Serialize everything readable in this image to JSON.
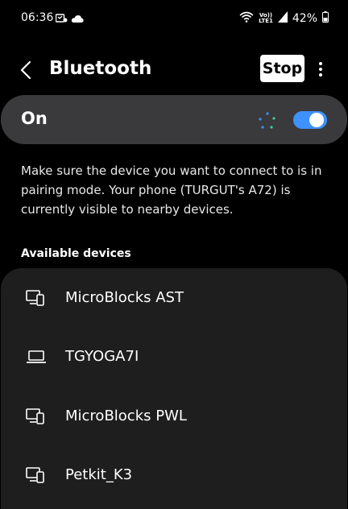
{
  "status_bar": {
    "time": "06:36",
    "left_icons": [
      "vpn-icon",
      "cloud-icon"
    ],
    "right_icons": [
      "wifi-icon",
      "volte-icon",
      "signal-icon",
      "battery-icon"
    ],
    "volte_line1": "Vo))",
    "volte_line2": "LTE1",
    "battery": "42%"
  },
  "header": {
    "title": "Bluetooth",
    "stop_label": "Stop"
  },
  "toggle": {
    "label": "On",
    "enabled": true,
    "accent": "#3e91ff"
  },
  "description": "Make sure the device you want to connect to is in pairing mode. Your phone (TURGUT's A72) is currently visible to nearby devices.",
  "available": {
    "header": "Available devices",
    "devices": [
      {
        "name": "MicroBlocks AST",
        "icon": "phone-desktop-icon"
      },
      {
        "name": "TGYOGA7I",
        "icon": "laptop-icon"
      },
      {
        "name": "MicroBlocks PWL",
        "icon": "phone-desktop-icon"
      },
      {
        "name": "Petkit_K3",
        "icon": "phone-desktop-icon"
      }
    ]
  },
  "colors": {
    "background": "#000000",
    "card": "#3a3a3c",
    "list_card": "#1e1e1e",
    "accent": "#3e91ff"
  }
}
